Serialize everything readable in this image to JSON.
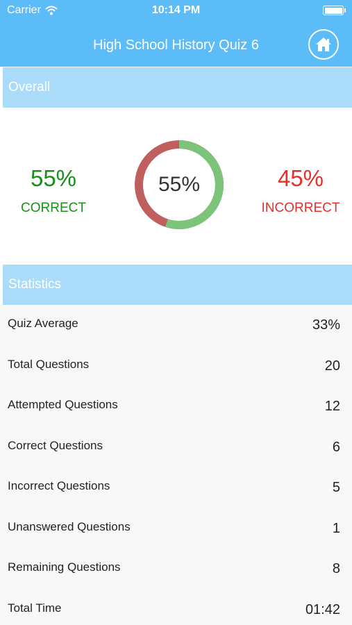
{
  "status_bar": {
    "carrier": "Carrier",
    "time": "10:14 PM"
  },
  "header": {
    "title": "High School History Quiz 6"
  },
  "overall": {
    "heading": "Overall",
    "correct_pct": "55%",
    "correct_label": "CORRECT",
    "incorrect_pct": "45%",
    "incorrect_label": "INCORRECT",
    "donut_center": "55%",
    "correct_fraction": 0.55,
    "colors": {
      "correct": "#1a8f18",
      "incorrect": "#e5312b",
      "ring_correct": "#7cc47a",
      "ring_incorrect": "#c0605e"
    }
  },
  "statistics": {
    "heading": "Statistics",
    "rows": [
      {
        "label": "Quiz Average",
        "value": "33%"
      },
      {
        "label": "Total Questions",
        "value": "20"
      },
      {
        "label": "Attempted Questions",
        "value": "12"
      },
      {
        "label": "Correct Questions",
        "value": "6"
      },
      {
        "label": "Incorrect Questions",
        "value": "5"
      },
      {
        "label": "Unanswered Questions",
        "value": "1"
      },
      {
        "label": "Remaining Questions",
        "value": "8"
      },
      {
        "label": "Total Time",
        "value": "01:42"
      }
    ]
  },
  "icons": {
    "home": "home-icon",
    "wifi": "wifi-icon",
    "battery": "battery-icon"
  }
}
